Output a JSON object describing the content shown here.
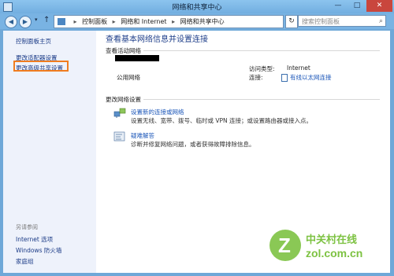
{
  "window": {
    "title": "网络和共享中心",
    "controls": {
      "minimize": "—",
      "maximize": "□",
      "close": "✕"
    }
  },
  "address_bar": {
    "crumbs": [
      "控制面板",
      "网络和 Internet",
      "网络和共享中心"
    ],
    "separator": "▸",
    "search_placeholder": "搜索控制面板"
  },
  "sidebar": {
    "items": [
      "控制面板主页",
      "更改适配器设置",
      "更改高级共享设置"
    ],
    "see_also_label": "另请参阅",
    "see_also_items": [
      "Internet 选项",
      "Windows 防火墙",
      "家庭组"
    ]
  },
  "main": {
    "heading": "查看基本网络信息并设置连接",
    "active_networks_label": "查看活动网络",
    "network_type": "公用网络",
    "access_type_label": "访问类型:",
    "access_type_value": "Internet",
    "connections_label": "连接:",
    "connection_value": "有线以太网连接",
    "change_settings_label": "更改网络设置",
    "tasks": [
      {
        "link": "设置新的连接或网络",
        "desc": "设置无线、宽带、拨号、临时或 VPN 连接；或设置路由器或接入点。"
      },
      {
        "link": "疑难解答",
        "desc": "诊断并修复网络问题，或者获得故障排除信息。"
      }
    ]
  },
  "watermark": {
    "brand": "中关村在线",
    "domain": "zol.com.cn",
    "color": "#7dc242"
  },
  "colors": {
    "accent_link": "#1a55b8",
    "highlight_box": "#f07c1f",
    "titlebar": "#8cc4ee",
    "close_button": "#c9463d"
  }
}
